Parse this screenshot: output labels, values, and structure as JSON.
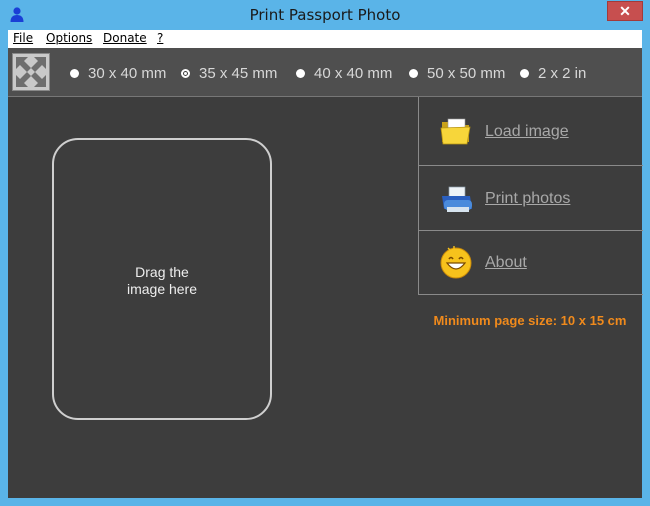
{
  "window": {
    "title": "Print Passport Photo",
    "close_glyph": "✕"
  },
  "menu": {
    "file": "File",
    "options": "Options",
    "donate": "Donate",
    "help": "?"
  },
  "toolbar": {
    "fullscreen_icon": "expand-arrows-icon",
    "sizes": [
      {
        "label": "30 x 40 mm",
        "selected": false
      },
      {
        "label": "35 x 45 mm",
        "selected": true
      },
      {
        "label": "40 x 40 mm",
        "selected": false
      },
      {
        "label": "50 x 50 mm",
        "selected": false
      },
      {
        "label": "2 x 2 in",
        "selected": false
      }
    ]
  },
  "dropzone": {
    "line1": "Drag the",
    "line2": "image here"
  },
  "actions": {
    "load": {
      "label": "Load image",
      "icon": "folder-icon"
    },
    "print": {
      "label": "Print photos",
      "icon": "printer-icon"
    },
    "about": {
      "label": "About",
      "icon": "smiley-icon"
    }
  },
  "notice": {
    "min_page_size": "Minimum page size: 10 x 15 cm"
  },
  "colors": {
    "title_bar": "#5ab4e8",
    "panel_bg": "#3d3d3d",
    "accent_orange": "#f08a1c",
    "close_red": "#c74f4f"
  }
}
